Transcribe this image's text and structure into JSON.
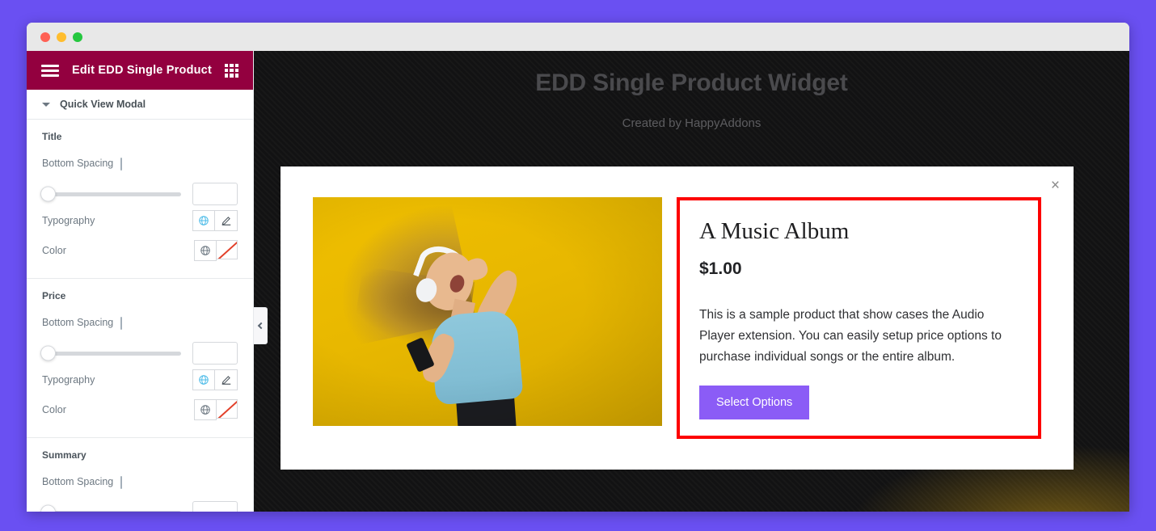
{
  "browser": {
    "traffic_lights": [
      "close",
      "minimize",
      "maximize"
    ]
  },
  "panel": {
    "title": "Edit EDD Single Product",
    "menu_icon": "hamburger-icon",
    "apps_icon": "grid-icon",
    "section": {
      "title": "Quick View Modal",
      "caret": "caret-down-icon"
    },
    "groups": [
      {
        "label": "Title",
        "spacing_label": "Bottom Spacing",
        "spacing_value": "",
        "spacing_placeholder": "",
        "device_icon": "monitor-icon",
        "typography_label": "Typography",
        "color_label": "Color"
      },
      {
        "label": "Price",
        "spacing_label": "Bottom Spacing",
        "spacing_value": "",
        "spacing_placeholder": "",
        "device_icon": "monitor-icon",
        "typography_label": "Typography",
        "color_label": "Color"
      },
      {
        "label": "Summary",
        "spacing_label": "Bottom Spacing",
        "spacing_value": "",
        "spacing_placeholder": "",
        "device_icon": "monitor-icon"
      }
    ],
    "collapse_icon": "chevron-left-icon"
  },
  "preview": {
    "title": "EDD Single Product Widget",
    "subtitle": "Created by HappyAddons",
    "modal": {
      "close_icon": "close-icon",
      "close_label": "×",
      "image_alt": "woman-with-headphones-photo",
      "product_title": "A Music Album",
      "product_price": "$1.00",
      "product_description": "This is a sample product that show cases the Audio Player extension. You can easily setup price options to purchase individual songs or the entire album.",
      "select_options_label": "Select Options"
    }
  },
  "colors": {
    "page_background": "#6a50f2",
    "panel_header": "#93003f",
    "preview_background": "#121213",
    "highlight_border": "#fd0000",
    "button_purple": "#8b5cf6",
    "image_yellow": "#e8b800"
  }
}
